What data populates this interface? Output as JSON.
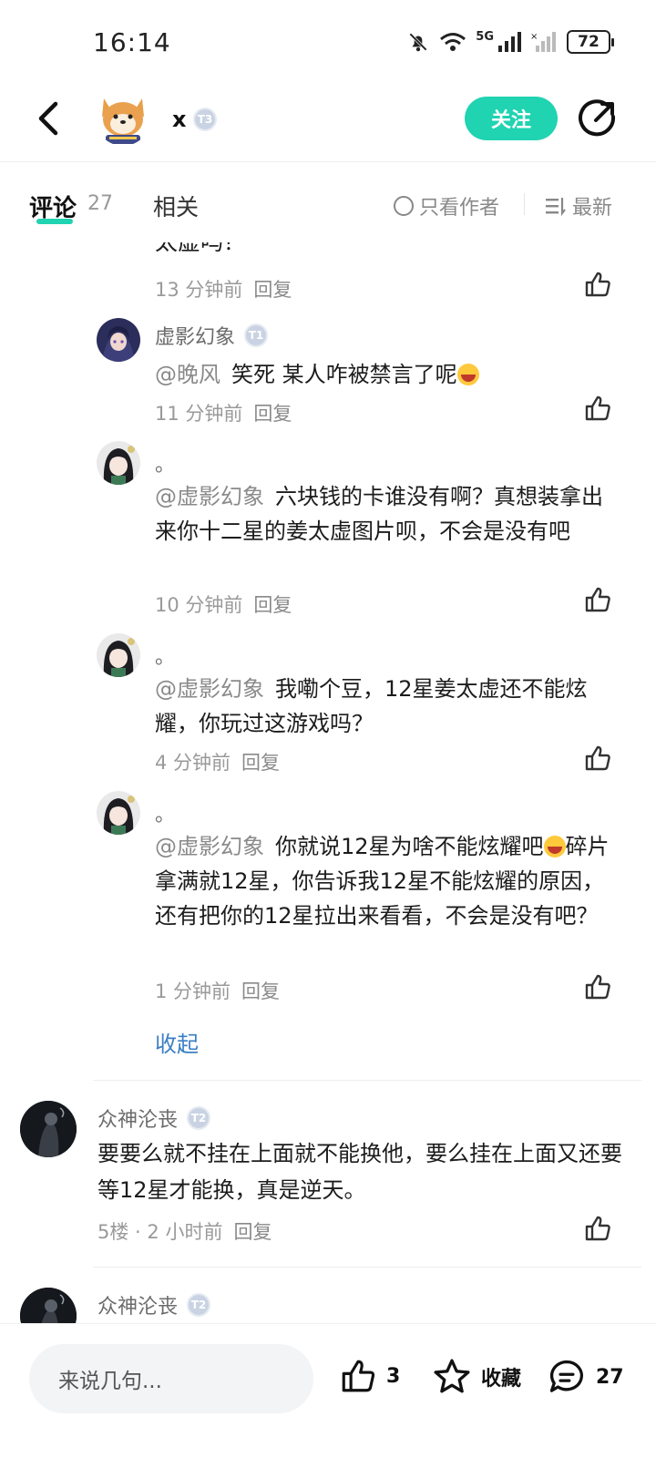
{
  "status": {
    "time": "16:14",
    "battery": "72",
    "network": "5G"
  },
  "header": {
    "author_name": "x",
    "level": "T3",
    "follow_label": "关注"
  },
  "tabs": {
    "comments_label": "评论",
    "comments_count": "27",
    "related_label": "相关",
    "only_author_label": "只看作者",
    "sort_label": "最新"
  },
  "replies": [
    {
      "text": "太虚吗？",
      "time": "13 分钟前",
      "reply_label": "回复"
    },
    {
      "name": "虚影幻象",
      "level": "T1",
      "mention": "@晚风",
      "text": "笑死 某人咋被禁言了呢",
      "time": "11 分钟前",
      "reply_label": "回复"
    },
    {
      "name": "。",
      "mention": "@虚影幻象",
      "text": "六块钱的卡谁没有啊？真想装拿出来你十二星的姜太虚图片呗，不会是没有吧",
      "time": "10 分钟前",
      "reply_label": "回复"
    },
    {
      "name": "。",
      "mention": "@虚影幻象",
      "text": "我嘞个豆，12星姜太虚还不能炫耀，你玩过这游戏吗？",
      "time": "4 分钟前",
      "reply_label": "回复"
    },
    {
      "name": "。",
      "mention": "@虚影幻象",
      "text_before": "你就说12星为啥不能炫耀吧",
      "text_after": "碎片拿满就12星，你告诉我12星不能炫耀的原因，还有把你的12星拉出来看看，不会是没有吧？",
      "time": "1 分钟前",
      "reply_label": "回复"
    }
  ],
  "collapse_label": "收起",
  "comments": [
    {
      "name": "众神沦丧",
      "level": "T2",
      "text": "要要么就不挂在上面就不能换他，要么挂在上面又还要等12星才能换，真是逆天。",
      "floor": "5楼",
      "time": "2 小时前",
      "reply_label": "回复"
    },
    {
      "name": "众神沦丧",
      "level": "T2"
    }
  ],
  "bottom_bar": {
    "input_placeholder": "来说几句...",
    "likes": "3",
    "collect_label": "收藏",
    "comments": "27"
  },
  "colors": {
    "accent": "#20d3b1",
    "link": "#3b7fc4"
  }
}
